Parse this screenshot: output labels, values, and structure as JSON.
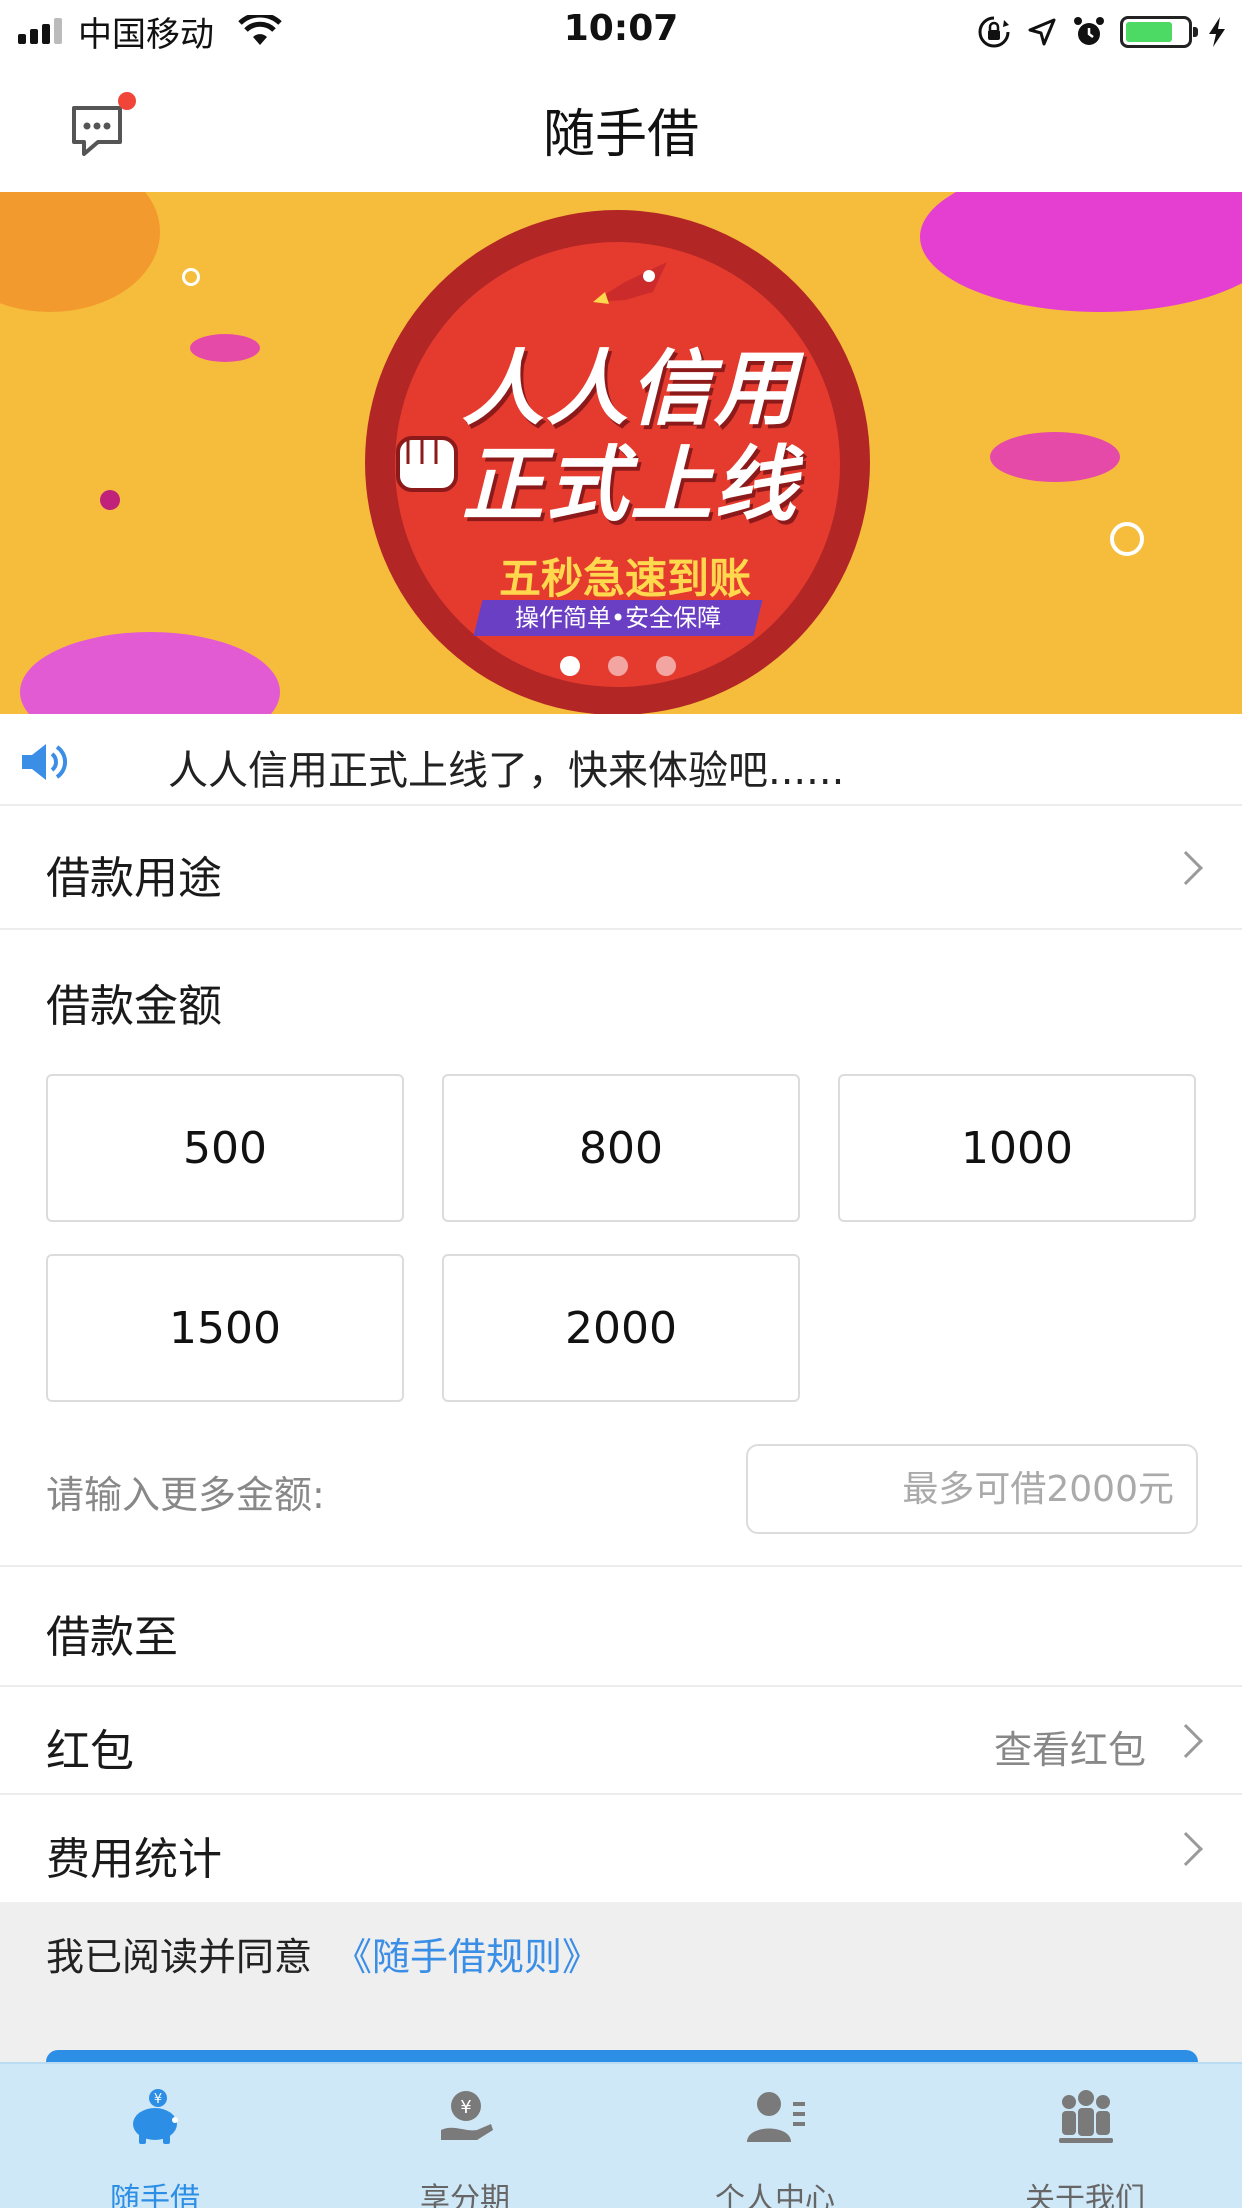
{
  "status_bar": {
    "carrier": "中国移动",
    "time": "10:07"
  },
  "nav": {
    "title": "随手借"
  },
  "banner": {
    "headline_line1": "人人信用",
    "headline_line2": "正式上线",
    "subheadline": "五秒急速到账",
    "tagline": "操作简单•安全保障",
    "active_page": 1,
    "page_count": 3
  },
  "notice": {
    "text": "人人信用正式上线了，快来体验吧......"
  },
  "loan_purpose": {
    "label": "借款用途"
  },
  "loan_amount": {
    "title": "借款金额",
    "options": [
      "500",
      "800",
      "1000",
      "1500",
      "2000"
    ],
    "more_label": "请输入更多金额:",
    "more_placeholder": "最多可借2000元"
  },
  "borrow_to": {
    "label": "借款至"
  },
  "red_packet": {
    "label": "红包",
    "action": "查看红包"
  },
  "fees": {
    "label": "费用统计"
  },
  "agreement": {
    "text": "我已阅读并同意",
    "link": "《随手借规则》"
  },
  "tabs": [
    {
      "label": "随手借",
      "icon": "piggy-bank-icon",
      "active": true
    },
    {
      "label": "享分期",
      "icon": "yen-hand-icon",
      "active": false
    },
    {
      "label": "个人中心",
      "icon": "user-profile-icon",
      "active": false
    },
    {
      "label": "关于我们",
      "icon": "group-icon",
      "active": false
    }
  ],
  "colors": {
    "accent": "#2d8ee6",
    "tab_bar_bg": "#cfe8f7",
    "banner_bg": "#f6bd3c",
    "notification_dot": "#f2453a"
  }
}
